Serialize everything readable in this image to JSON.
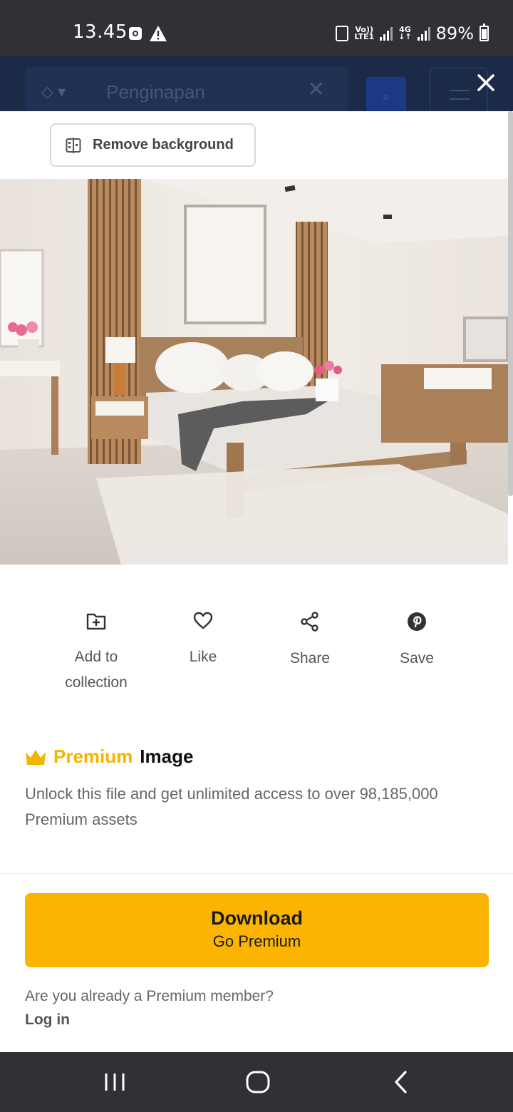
{
  "status_bar": {
    "time": "13.45",
    "network_label_top": "Vo))",
    "network_label_bottom": "LTE1",
    "network2_label_top": "4G",
    "network2_label_bottom": "↓↑",
    "battery": "89%"
  },
  "background_app": {
    "search_text": "Penginapan"
  },
  "modal": {
    "remove_background_label": "Remove background",
    "actions": [
      {
        "label": "Add to collection",
        "icon": "folder-plus-icon"
      },
      {
        "label": "Like",
        "icon": "heart-icon"
      },
      {
        "label": "Share",
        "icon": "share-icon"
      },
      {
        "label": "Save",
        "icon": "pinterest-icon"
      }
    ],
    "premium": {
      "word": "Premium",
      "suffix": "Image",
      "description": "Unlock this file and get unlimited access to over 98,185,000 Premium assets"
    },
    "download": {
      "title": "Download",
      "subtitle": "Go Premium"
    },
    "already_member": "Are you already a Premium member?",
    "login": "Log in"
  },
  "colors": {
    "accent": "#fbb500",
    "premium_text": "#f5b400",
    "status_bar": "#2f3136",
    "background_app": "#1b2a47"
  }
}
